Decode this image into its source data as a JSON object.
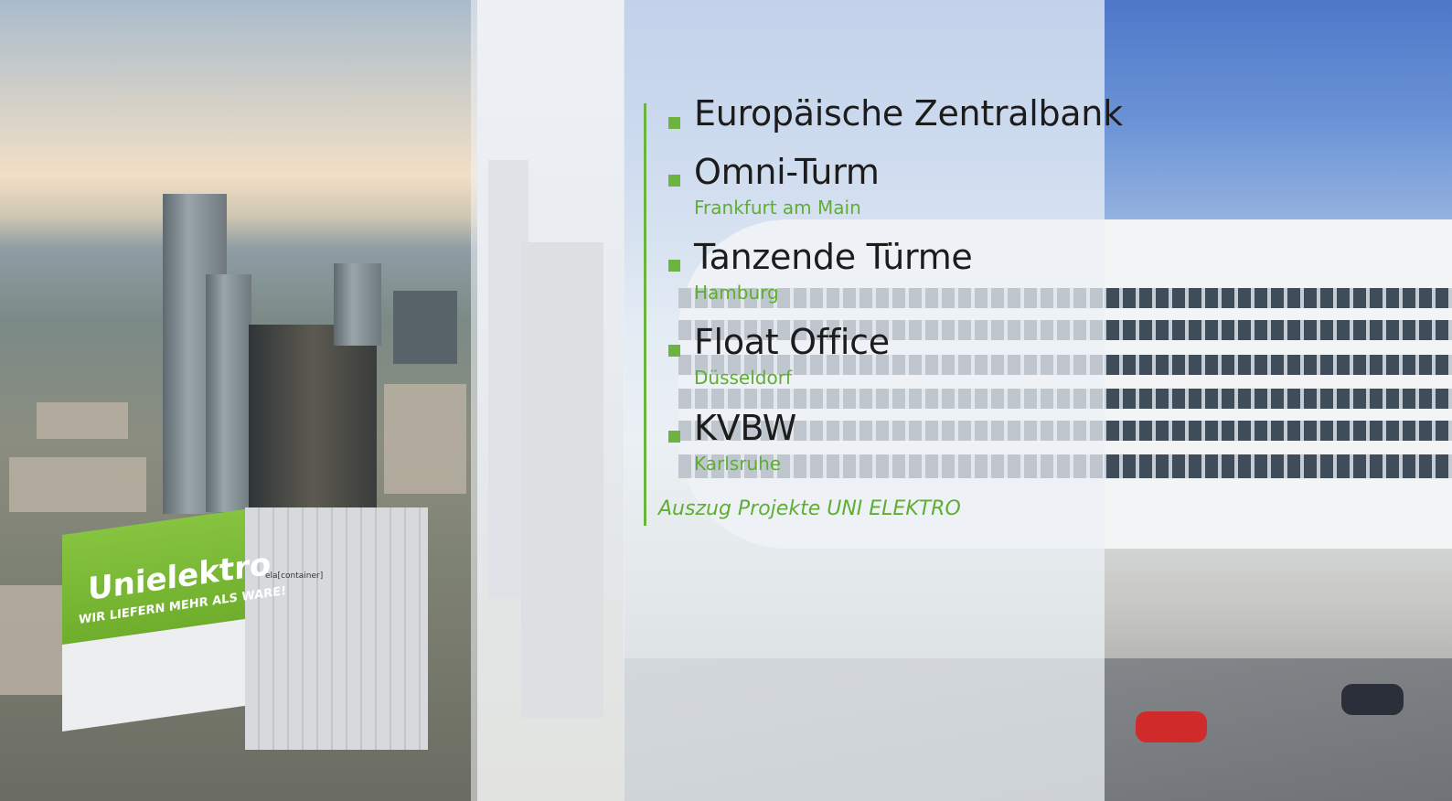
{
  "projects": [
    {
      "title": "Europäische Zentralbank",
      "location": ""
    },
    {
      "title": "Omni-Turm",
      "location": "Frankfurt am Main"
    },
    {
      "title": "Tanzende Türme",
      "location": "Hamburg"
    },
    {
      "title": "Float Office",
      "location": "Düsseldorf"
    },
    {
      "title": "KVBW",
      "location": "Karlsruhe"
    }
  ],
  "caption": "Auszug Projekte UNI ELEKTRO",
  "container": {
    "logo": "Unielektro",
    "slogan": "WIR LIEFERN MEHR ALS WARE!",
    "brand_plate": "ela[container]"
  },
  "colors": {
    "accent_green": "#6db33f",
    "text_dark": "#1c1c1c",
    "panel_overlay": "#ecf1f6"
  },
  "icons": [
    "square-bullet-icon"
  ]
}
